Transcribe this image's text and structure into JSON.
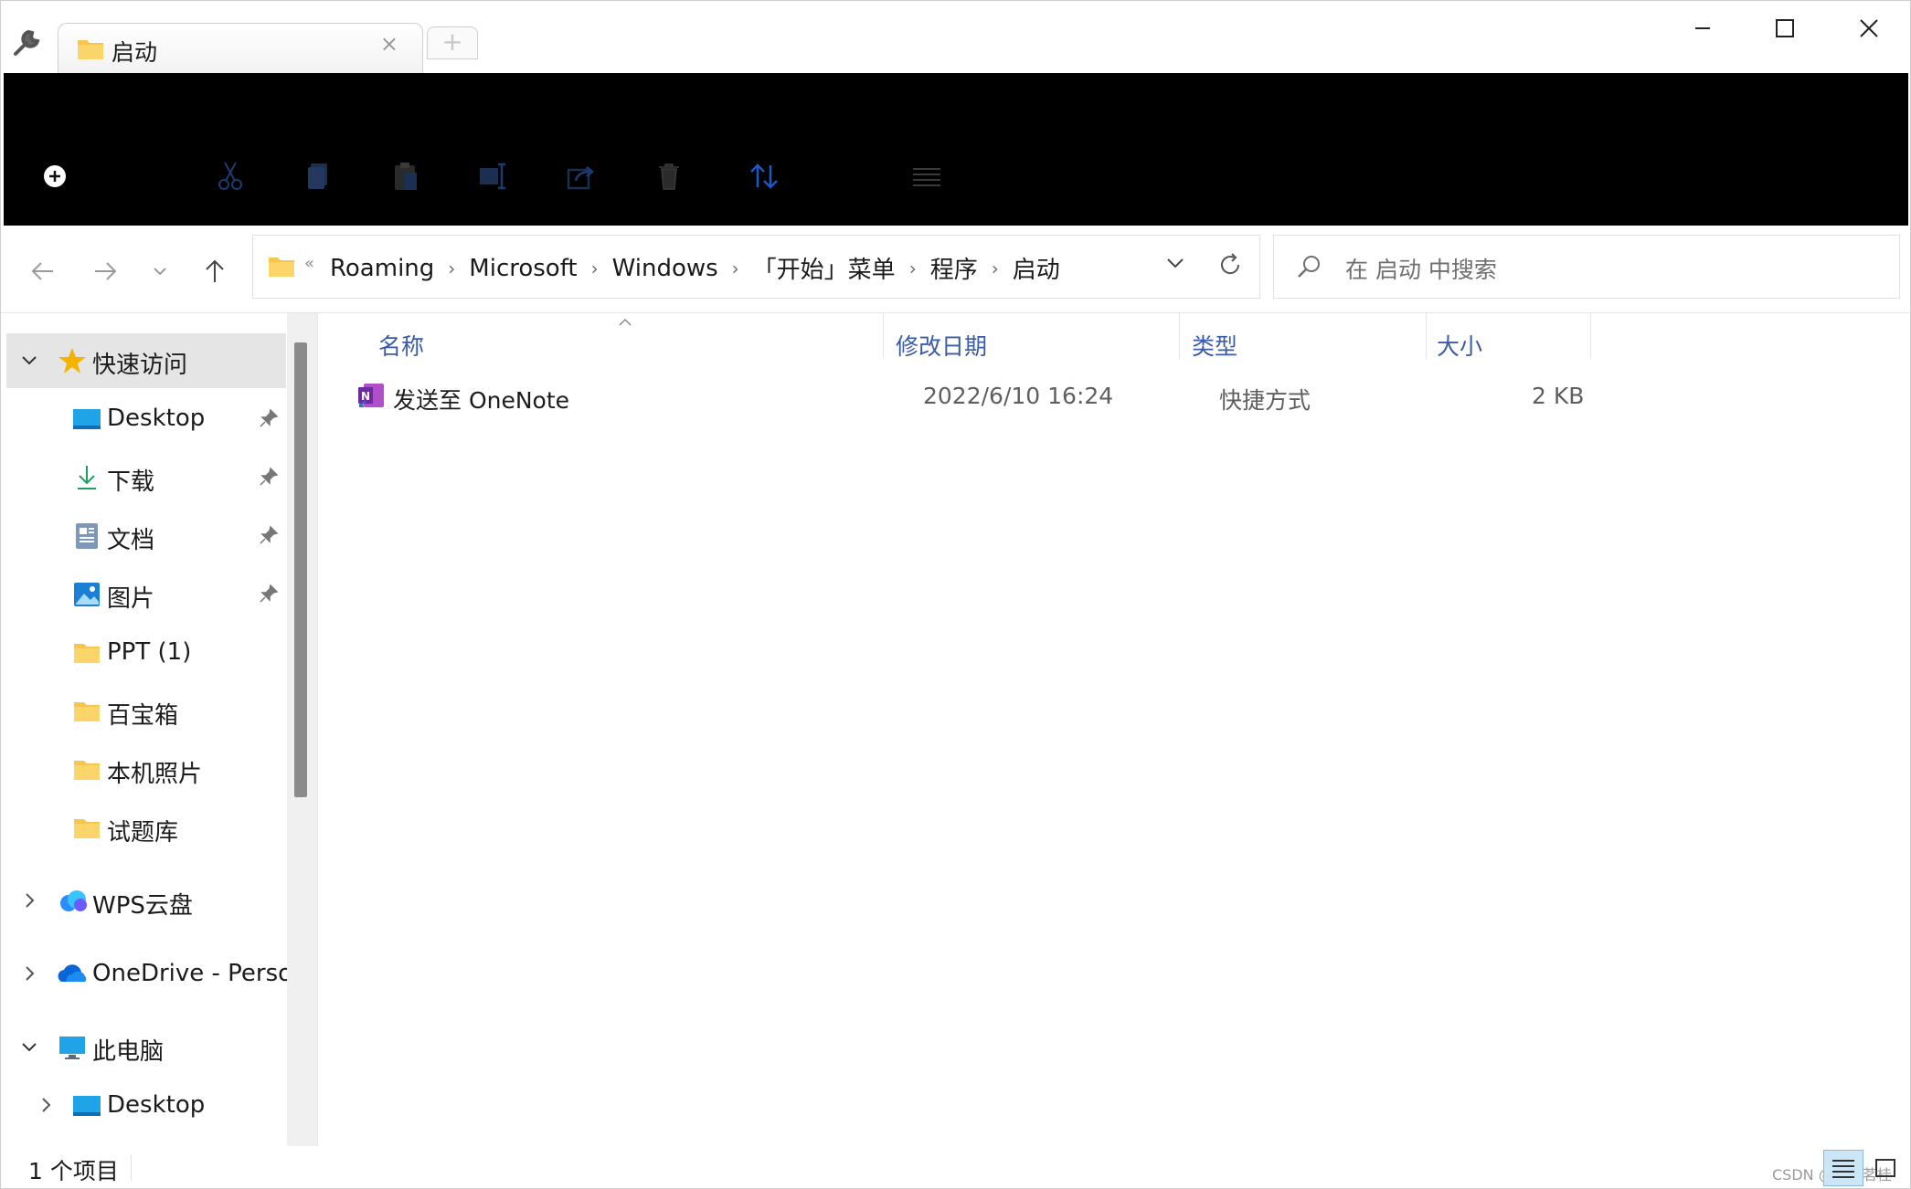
{
  "window": {
    "tab_title": "启动",
    "tab_close": "×",
    "new_tab": "+"
  },
  "address": {
    "chevron_left": "«",
    "breadcrumbs": [
      "Roaming",
      "Microsoft",
      "Windows",
      "「开始」菜单",
      "程序",
      "启动"
    ],
    "separator": "›"
  },
  "search": {
    "placeholder": "在 启动 中搜索"
  },
  "sidebar": {
    "items": [
      {
        "label": "快速访问",
        "type": "quick-access"
      },
      {
        "label": "Desktop",
        "type": "desktop"
      },
      {
        "label": "下载",
        "type": "download"
      },
      {
        "label": "文档",
        "type": "document"
      },
      {
        "label": "图片",
        "type": "picture"
      },
      {
        "label": "PPT (1)",
        "type": "folder"
      },
      {
        "label": "百宝箱",
        "type": "folder"
      },
      {
        "label": "本机照片",
        "type": "folder"
      },
      {
        "label": "试题库",
        "type": "folder"
      },
      {
        "label": "WPS云盘",
        "type": "cloud"
      },
      {
        "label": "OneDrive - Person",
        "type": "onedrive"
      },
      {
        "label": "此电脑",
        "type": "pc"
      },
      {
        "label": "Desktop",
        "type": "desktop"
      }
    ]
  },
  "columns": {
    "name": "名称",
    "date": "修改日期",
    "type": "类型",
    "size": "大小"
  },
  "files": [
    {
      "name": "发送至 OneNote",
      "date": "2022/6/10 16:24",
      "type": "快捷方式",
      "size": "2 KB"
    }
  ],
  "status": {
    "count": "1 个项目",
    "watermark": "CSDN @苍苏茗桂"
  },
  "colors": {
    "header_text": "#3a5ba8",
    "toolbar_bg": "#000000",
    "selected_bg": "#e5e5e5",
    "folder_yellow": "#f8c64b"
  }
}
